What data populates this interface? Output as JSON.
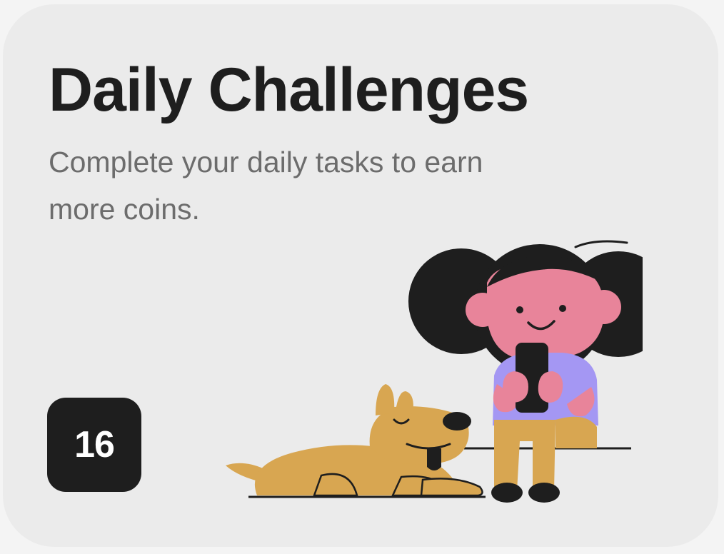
{
  "card": {
    "title": "Daily Challenges",
    "subtitle": "Complete your daily tasks to earn more coins.",
    "badge_count": "16"
  },
  "illustration": {
    "icon": "girl-with-phone-and-dog-illustration",
    "colors": {
      "hair": "#1e1e1e",
      "skin": "#e8849a",
      "shirt": "#a497f3",
      "pants": "#d8a651",
      "dog": "#d8a651",
      "outline": "#1e1e1e"
    }
  },
  "colors": {
    "card_background": "#ebebeb",
    "title": "#1e1e1e",
    "subtitle": "#6c6c6c",
    "badge_background": "#1e1e1e",
    "badge_text": "#ffffff"
  }
}
